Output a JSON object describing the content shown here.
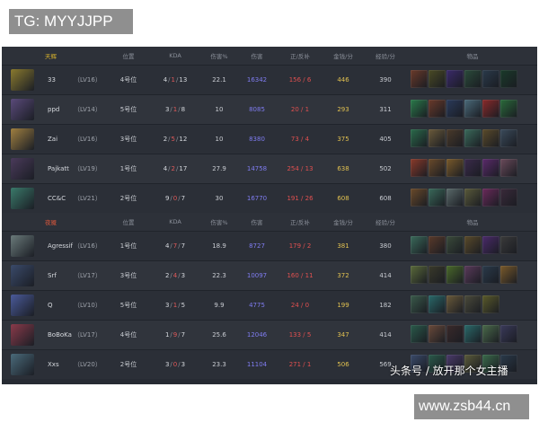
{
  "overlay": {
    "tg_label": "TG: MYYJJPP",
    "watermark": "头条号 / 放开那个女主播",
    "site": "www.zsb44.cn"
  },
  "colors": {
    "panel": "#272b33",
    "radiant": "#d6b12c",
    "dire": "#d8573c",
    "damage": "#7f7cf0",
    "last_hits": "#e05050",
    "gold": "#e0c050"
  },
  "headers": {
    "position": "位置",
    "kda": "KDA",
    "damage_pct": "伤害%",
    "damage": "伤害",
    "last_hits": "正/反补",
    "gpm": "金钱/分",
    "xpm": "经验/分",
    "items": "物品"
  },
  "teams": [
    {
      "name": "天辉",
      "side": "radiant",
      "players": [
        {
          "name": "33",
          "level": "（LV16）",
          "position": "4号位",
          "kda": {
            "k": "4",
            "d": "1",
            "a": "13"
          },
          "damage_pct": "22.1",
          "damage": "16342",
          "last_hits": "156 / 6",
          "gpm": "446",
          "xpm": "390",
          "hero_color": "#8a7a2e",
          "items": [
            "#6a3a2a",
            "#4a4a24",
            "#3a2a6a",
            "#2a4a3a",
            "#2a3a4a",
            "#1a3a2a"
          ]
        },
        {
          "name": "ppd",
          "level": "（LV14）",
          "position": "5号位",
          "kda": {
            "k": "3",
            "d": "1",
            "a": "8"
          },
          "damage_pct": "10",
          "damage": "8085",
          "last_hits": "20 / 1",
          "gpm": "293",
          "xpm": "311",
          "hero_color": "#5a4a7a",
          "items": [
            "#2a7a4a",
            "#6a3a2a",
            "#2a3a5a",
            "#4a6a7a",
            "#8a2a2a",
            "#2a6a3a"
          ]
        },
        {
          "name": "Zai",
          "level": "（LV16）",
          "position": "3号位",
          "kda": {
            "k": "2",
            "d": "5",
            "a": "12"
          },
          "damage_pct": "10",
          "damage": "8380",
          "last_hits": "73 / 4",
          "gpm": "375",
          "xpm": "405",
          "hero_color": "#a08040",
          "items": [
            "#2a6a4a",
            "#6a5a3a",
            "#4a3a2a",
            "#3a6a5a",
            "#5a4a2a",
            "#3a4a5a"
          ]
        },
        {
          "name": "Pajkatt",
          "level": "（LV19）",
          "position": "1号位",
          "kda": {
            "k": "4",
            "d": "2",
            "a": "17"
          },
          "damage_pct": "27.9",
          "damage": "14758",
          "last_hits": "254 / 13",
          "gpm": "638",
          "xpm": "502",
          "hero_color": "#4a3a5a",
          "items": [
            "#8a3a2a",
            "#6a4a2a",
            "#7a5a2a",
            "#3a2a4a",
            "#5a2a6a",
            "#6a4a5a"
          ]
        },
        {
          "name": "CC&C",
          "level": "（LV21）",
          "position": "2号位",
          "kda": {
            "k": "9",
            "d": "0",
            "a": "7"
          },
          "damage_pct": "30",
          "damage": "16770",
          "last_hits": "191 / 26",
          "gpm": "608",
          "xpm": "608",
          "hero_color": "#3a7a6a",
          "items": [
            "#6a4a2a",
            "#3a6a5a",
            "#5a6a6a",
            "#5a5a3a",
            "#6a2a5a",
            "#3a2a3a"
          ]
        }
      ]
    },
    {
      "name": "夜魇",
      "side": "dire",
      "players": [
        {
          "name": "Agressif",
          "level": "（LV16）",
          "position": "1号位",
          "kda": {
            "k": "4",
            "d": "7",
            "a": "7"
          },
          "damage_pct": "18.9",
          "damage": "8727",
          "last_hits": "179 / 2",
          "gpm": "381",
          "xpm": "380",
          "hero_color": "#6a7a7a",
          "items": [
            "#3a6a5a",
            "#5a3a2a",
            "#3a4a3a",
            "#5a4a2a",
            "#4a2a6a",
            "#3a3a3a"
          ]
        },
        {
          "name": "Srf",
          "level": "（LV17）",
          "position": "3号位",
          "kda": {
            "k": "2",
            "d": "4",
            "a": "3"
          },
          "damage_pct": "22.3",
          "damage": "10097",
          "last_hits": "160 / 11",
          "gpm": "372",
          "xpm": "414",
          "hero_color": "#3a4a6a",
          "items": [
            "#5a6a3a",
            "#3a3a2a",
            "#4a6a2a",
            "#5a3a5a",
            "#2a3a4a",
            "#7a5a2a"
          ]
        },
        {
          "name": "Q",
          "level": "（LV10）",
          "position": "5号位",
          "kda": {
            "k": "3",
            "d": "1",
            "a": "5"
          },
          "damage_pct": "9.9",
          "damage": "4775",
          "last_hits": "24 / 0",
          "gpm": "199",
          "xpm": "182",
          "hero_color": "#4a5a9a",
          "items": [
            "#3a5a4a",
            "#2a6a6a",
            "#6a5a3a",
            "#4a4a3a",
            "#5a5a2a"
          ]
        },
        {
          "name": "BoBoKa",
          "level": "（LV17）",
          "position": "4号位",
          "kda": {
            "k": "1",
            "d": "9",
            "a": "7"
          },
          "damage_pct": "25.6",
          "damage": "12046",
          "last_hits": "133 / 5",
          "gpm": "347",
          "xpm": "414",
          "hero_color": "#8a3a4a",
          "items": [
            "#2a5a4a",
            "#6a4a3a",
            "#3a2a2a",
            "#2a6a6a",
            "#4a6a4a",
            "#3a3a5a"
          ]
        },
        {
          "name": "Xxs",
          "level": "（LV20）",
          "position": "2号位",
          "kda": {
            "k": "3",
            "d": "0",
            "a": "3"
          },
          "damage_pct": "23.3",
          "damage": "11104",
          "last_hits": "271 / 1",
          "gpm": "506",
          "xpm": "569",
          "hero_color": "#4a6a7a",
          "items": [
            "#3a4a6a",
            "#2a5a4a",
            "#4a3a6a",
            "#5a5a3a",
            "#3a6a4a",
            "#2a3a4a"
          ]
        }
      ]
    }
  ]
}
